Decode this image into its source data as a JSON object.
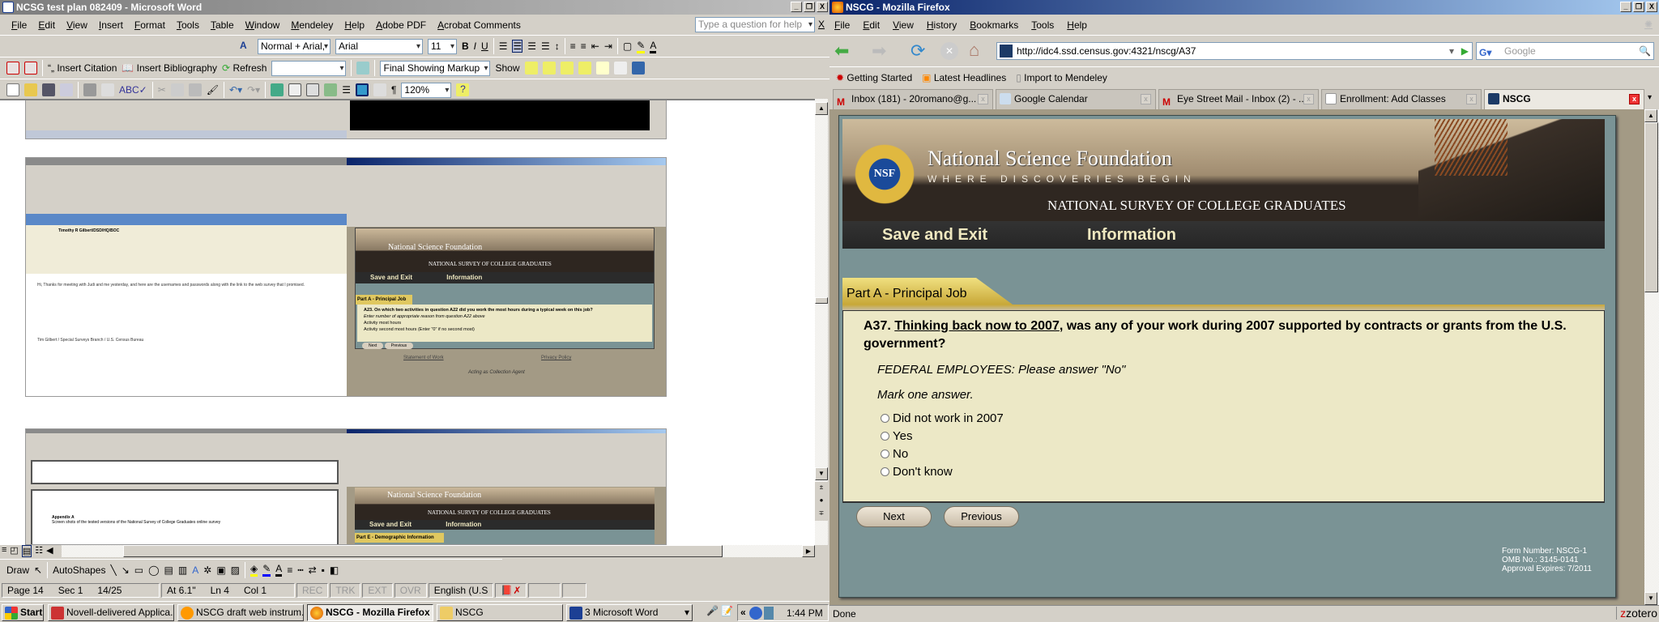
{
  "word": {
    "title": "NCSG test plan 082409 - Microsoft Word",
    "menu": [
      "File",
      "Edit",
      "View",
      "Insert",
      "Format",
      "Tools",
      "Table",
      "Window",
      "Mendeley",
      "Help",
      "Adobe PDF",
      "Acrobat Comments"
    ],
    "help_placeholder": "Type a question for help",
    "style": "Normal + Arial,",
    "font": "Arial",
    "size": "11",
    "insert_citation": "Insert Citation",
    "insert_bibliography": "Insert Bibliography",
    "refresh": "Refresh",
    "markup": "Final Showing Markup",
    "show": "Show",
    "zoom": "120%",
    "draw": "Draw",
    "autoshapes": "AutoShapes",
    "status": {
      "page": "Page 14",
      "sec": "Sec 1",
      "pages": "14/25",
      "at": "At 6.1\"",
      "ln": "Ln 4",
      "col": "Col 1",
      "rec": "REC",
      "trk": "TRK",
      "ext": "EXT",
      "ovr": "OVR",
      "lang": "English (U.S"
    },
    "doc": {
      "shot_nsf": "National Science Foundation",
      "shot_tagline": "WHERE DISCOVERIES BEGIN",
      "shot_survey": "NATIONAL SURVEY OF COLLEGE GRADUATES",
      "shot_save": "Save and Exit",
      "shot_info": "Information",
      "shot_part_a": "Part A - Principal Job",
      "shot_q": "A23. On which two activities in question A22 did you work the most hours during a typical week on this job?",
      "shot_hint": "Enter number of appropriate reason from question A22 above",
      "shot_opt1": "Activity most hours",
      "shot_opt2": "Activity second most hours (Enter \"0\" if no second most)",
      "shot_next": "Next",
      "shot_prev": "Previous",
      "shot_sow": "Statement of Work",
      "shot_privacy": "Privacy Policy",
      "shot_agent": "Acting as Collection Agent",
      "shot_mail_sender": "Timothy R Gilbert/DSD/HQ/BOC",
      "shot_mail_body": "Hi, Thanks for meeting with Judi and me yesterday, and here are the usernames and passwords along with the link to the web survey that I promised.",
      "shot_mail_sig": "Tim Gilbert / Special Surveys Branch / U.S. Census Bureau",
      "appendix_title": "Appendix A",
      "appendix_text": "Screen shots of the tested versions of the National Survey of College Graduates online survey",
      "shot_part_e": "Part E - Demographic Information"
    }
  },
  "firefox": {
    "title": "NSCG - Mozilla Firefox",
    "menu": [
      "File",
      "Edit",
      "View",
      "History",
      "Bookmarks",
      "Tools",
      "Help"
    ],
    "url": "http://idc4.ssd.census.gov:4321/nscg/A37",
    "search_placeholder": "Google",
    "bookmarks": [
      "Getting Started",
      "Latest Headlines",
      "Import to Mendeley"
    ],
    "tabs": [
      "Inbox (181) - 20romano@g...",
      "Google Calendar",
      "Eye Street Mail - Inbox (2) - ...",
      "Enrollment: Add Classes",
      "NSCG"
    ],
    "status": "Done",
    "zotero": "zotero"
  },
  "page": {
    "org": "National Science Foundation",
    "tagline": "WHERE DISCOVERIES BEGIN",
    "logo": "NSF",
    "survey": "NATIONAL SURVEY OF COLLEGE GRADUATES",
    "nav": [
      "Save and Exit",
      "Information"
    ],
    "section": "Part A - Principal Job",
    "q_num": "A37.",
    "q_underlined": "Thinking back now to 2007",
    "q_rest": ", was any of your work during 2007 supported by contracts or grants from the U.S. government?",
    "instruction": "FEDERAL EMPLOYEES: Please answer \"No\"",
    "mark": "Mark one answer.",
    "options": [
      "Did not work in 2007",
      "Yes",
      "No",
      "Don't know"
    ],
    "next": "Next",
    "previous": "Previous",
    "form_number": "Form Number: NSCG-1",
    "omb": "OMB No.: 3145-0141",
    "expires": "Approval Expires: 7/2011",
    "colors": {
      "teal": "#7a9395",
      "cream": "#ece8c6",
      "gold": "#e0c860",
      "nav_text": "#efe8c0"
    }
  },
  "taskbar": {
    "start": "Start",
    "items": [
      "Novell-delivered Applica...",
      "NSCG draft web instrum...",
      "NSCG - Mozilla Firefox",
      "NSCG",
      "3 Microsoft Word"
    ],
    "clock": "1:44 PM"
  }
}
